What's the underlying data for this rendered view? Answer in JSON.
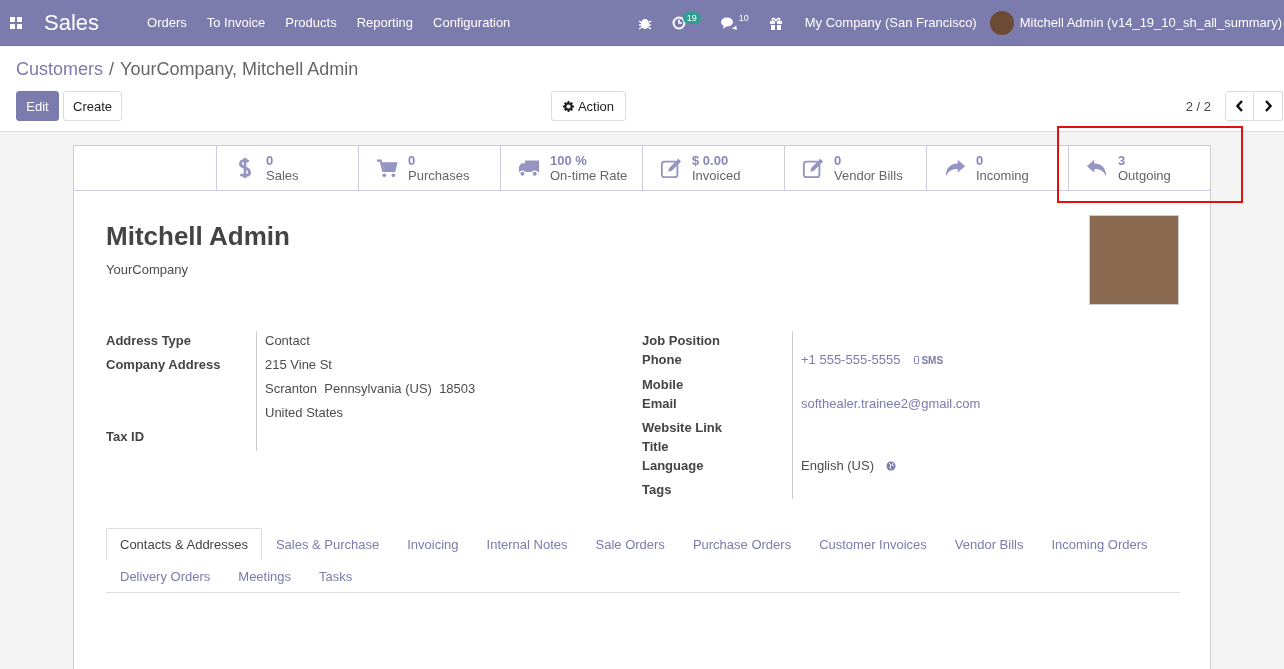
{
  "navbar": {
    "app": "Sales",
    "menu": [
      "Orders",
      "To Invoice",
      "Products",
      "Reporting",
      "Configuration"
    ],
    "systray": [
      {
        "kind": "bug"
      },
      {
        "kind": "activity",
        "badge": "19"
      },
      {
        "kind": "messages",
        "badge": "10"
      },
      {
        "kind": "gift"
      }
    ],
    "company": "My Company (San Francisco)",
    "user": "Mitchell Admin (v14_19_10_sh_all_summary)"
  },
  "breadcrumb": [
    "Customers",
    "YourCompany, Mitchell Admin"
  ],
  "breadcrumb_separator": "/",
  "buttons": {
    "edit": "Edit",
    "create": "Create",
    "action": "Action"
  },
  "pager": "2 / 2",
  "stat_buttons": [
    {
      "kind": "sales",
      "value": "0",
      "label": "Sales",
      "highlighted": false
    },
    {
      "kind": "purchases",
      "value": "0",
      "label": "Purchases",
      "highlighted": false
    },
    {
      "kind": "delivery",
      "value": "100 %",
      "label": "On-time Rate",
      "highlighted": false
    },
    {
      "kind": "invoice",
      "value": "$ 0.00",
      "label": "Invoiced",
      "highlighted": false
    },
    {
      "kind": "invoice",
      "value": "0",
      "label": "Vendor Bills",
      "highlighted": false
    },
    {
      "kind": "incoming",
      "value": "0",
      "label": "Incoming",
      "highlighted": false
    },
    {
      "kind": "outgoing",
      "value": "3",
      "label": "Outgoing",
      "highlighted": true
    }
  ],
  "partner": {
    "name": "Mitchell Admin",
    "company": "YourCompany"
  },
  "left_fields": [
    {
      "label": "Address Type",
      "values": [
        "Contact"
      ]
    },
    {
      "label": "Company Address",
      "values": [
        "215 Vine St",
        "Scranton  Pennsylvania (US)  18503",
        "United States"
      ]
    },
    {
      "label": "Tax ID"
    }
  ],
  "right_fields": [
    {
      "label": "Job Position",
      "kind": "text"
    },
    {
      "label": "Phone",
      "kind": "phone",
      "value": "+1 555-555-5555",
      "action": "SMS"
    },
    {
      "label": "Mobile",
      "kind": "text"
    },
    {
      "label": "Email",
      "kind": "link",
      "value": "softhealer.trainee2@gmail.com"
    },
    {
      "label": "Website Link",
      "kind": "text"
    },
    {
      "label": "Title",
      "kind": "text"
    },
    {
      "label": "Language",
      "kind": "language",
      "value": "English (US)"
    },
    {
      "label": "Tags",
      "kind": "text"
    }
  ],
  "tabs": [
    {
      "label": "Contacts & Addresses",
      "selected": true
    },
    {
      "label": "Sales & Purchase",
      "selected": false
    },
    {
      "label": "Invoicing",
      "selected": false
    },
    {
      "label": "Internal Notes",
      "selected": false
    },
    {
      "label": "Sale Orders",
      "selected": false
    },
    {
      "label": "Purchase Orders",
      "selected": false
    },
    {
      "label": "Customer Invoices",
      "selected": false
    },
    {
      "label": "Vendor Bills",
      "selected": false
    },
    {
      "label": "Incoming Orders",
      "selected": false
    },
    {
      "label": "Delivery Orders",
      "selected": false
    },
    {
      "label": "Meetings",
      "selected": false
    },
    {
      "label": "Tasks",
      "selected": false
    }
  ]
}
